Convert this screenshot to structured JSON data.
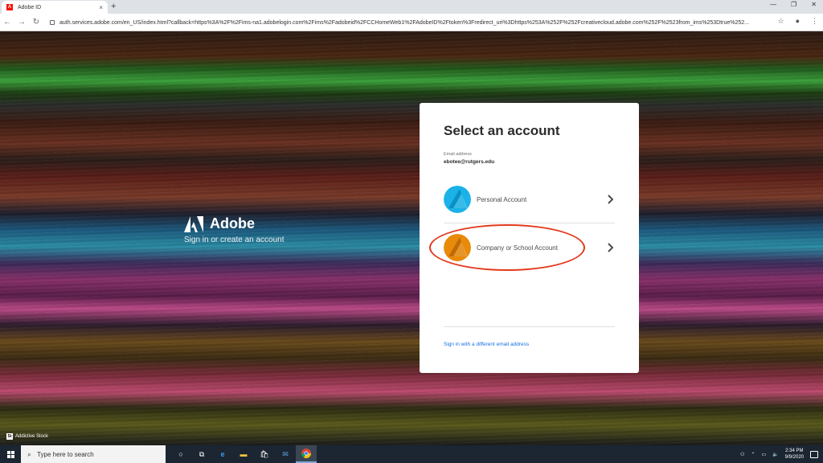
{
  "browser": {
    "tab_title": "Adobe ID",
    "tab_close": "×",
    "new_tab": "+",
    "url": "auth.services.adobe.com/en_US/index.html?callback=https%3A%2F%2Fims-na1.adobelogin.com%2Fims%2Fadobeid%2FCCHomeWeb1%2FAdobeID%2Ftoken%3Fredirect_uri%3Dhttps%253A%252F%252Fcreativecloud.adobe.com%252F%2523from_ims%253Dtrue%252..."
  },
  "brand": {
    "name": "Adobe",
    "subtitle": "Sign in or create an account"
  },
  "card": {
    "title": "Select an account",
    "email_label": "Email address",
    "email_value": "ebotee@rutgers.edu",
    "accounts": [
      {
        "label": "Personal Account",
        "color": "#1ab2e8"
      },
      {
        "label": "Company or School Account",
        "color": "#e88a0a"
      }
    ],
    "different_email_link": "Sign in with a different email address"
  },
  "credit": {
    "icon": "St",
    "text": "Addictive Stock"
  },
  "taskbar": {
    "search_placeholder": "Type here to search",
    "time": "2:34 PM",
    "date": "9/9/2020"
  },
  "colors": {
    "accent": "#1473e6",
    "highlight": "#e33a1e"
  }
}
